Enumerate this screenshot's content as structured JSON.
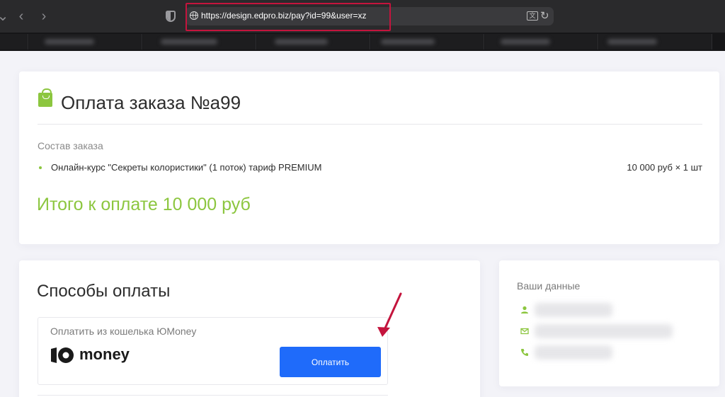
{
  "browser": {
    "url": "https://design.edpro.biz/pay?id=99&user=xz",
    "back_icon": "chevron-left-icon",
    "forward_icon": "chevron-right-icon",
    "translate_icon": "translate-icon",
    "reload_icon": "reload-icon"
  },
  "order": {
    "title": "Оплата заказа №а99",
    "composition_label": "Состав заказа",
    "items": [
      {
        "name": "Онлайн-курс \"Секреты колористики\" (1 поток) тариф PREMIUM",
        "price": "10 000 руб × 1 шт"
      }
    ],
    "total": "Итого к оплате 10 000 руб"
  },
  "payment": {
    "title": "Способы оплаты",
    "methods": [
      {
        "label": "Оплатить из кошелька ЮMoney",
        "logo_text": "money",
        "button_label": "Оплатить"
      }
    ]
  },
  "user_data": {
    "title": "Ваши данные",
    "rows": [
      {
        "icon": "user-icon"
      },
      {
        "icon": "email-icon"
      },
      {
        "icon": "phone-icon"
      }
    ]
  },
  "colors": {
    "accent_green": "#8cc63f",
    "button_blue": "#1f6bfa",
    "annotation_red": "#c4143d"
  }
}
